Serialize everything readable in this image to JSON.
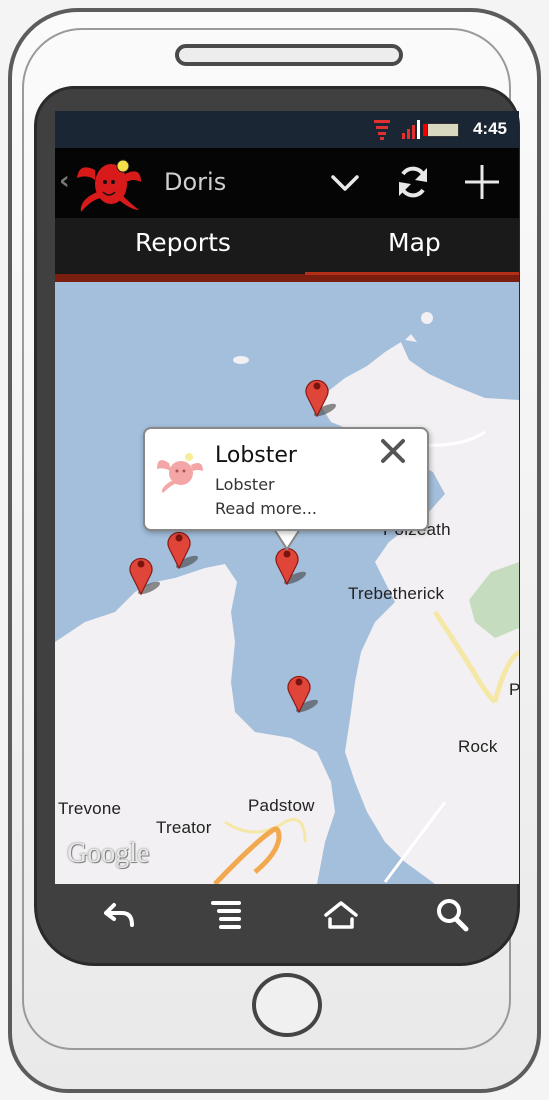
{
  "status_bar": {
    "time": "4:45"
  },
  "action_bar": {
    "title": "Doris"
  },
  "tabs": [
    {
      "label": "Reports"
    },
    {
      "label": "Map"
    }
  ],
  "map": {
    "places": [
      "Polzeath",
      "Trebetherick",
      "Rock",
      "Padstow",
      "Trevone",
      "Treator",
      "P"
    ],
    "attribution": "Google"
  },
  "info_window": {
    "title": "Lobster",
    "subtitle": "Lobster",
    "link": "Read more..."
  },
  "colors": {
    "water": "#a4bfdc",
    "land": "#f2f0f2",
    "tab_indicator": "#b42e18",
    "marker": "#e0453a"
  }
}
